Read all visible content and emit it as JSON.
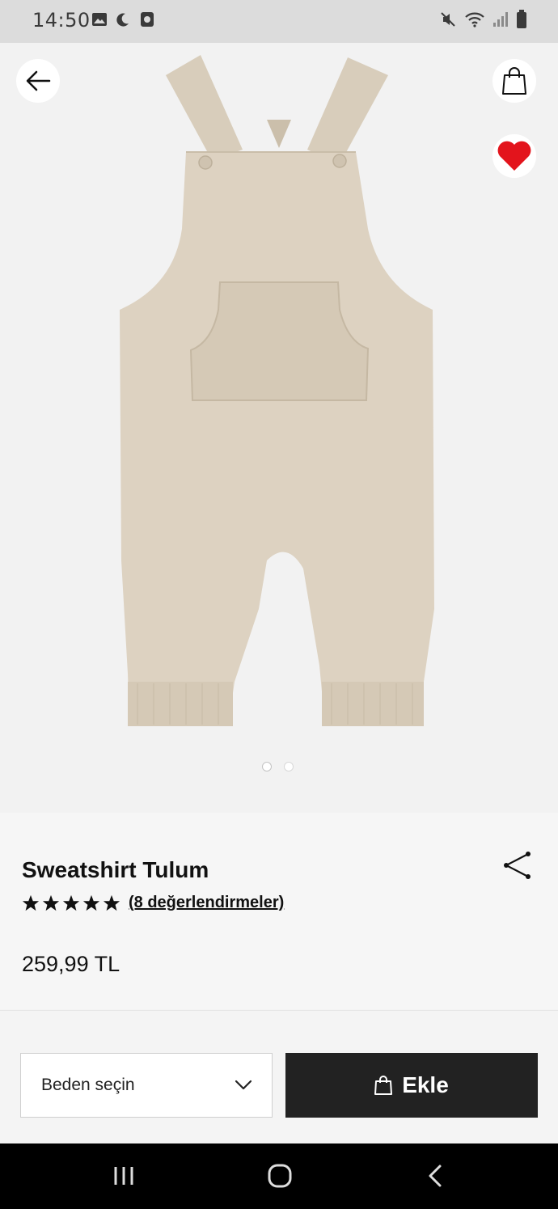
{
  "status_bar": {
    "time": "14:50",
    "left_icons": [
      "image-icon",
      "moon-icon",
      "app-notification-icon"
    ],
    "right_icons": [
      "mute-icon",
      "wifi-icon",
      "signal-icon",
      "battery-icon"
    ]
  },
  "hero": {
    "image_subject": "beige sweatshirt dungarees",
    "page_indicator": {
      "total": 2,
      "active": 1
    }
  },
  "product": {
    "title": "Sweatshirt Tulum",
    "rating_stars": 5,
    "reviews_link": "(8 değerlendirmeler)",
    "price": "259,99 TL"
  },
  "actions": {
    "size_placeholder": "Beden seçin",
    "add_label": "Ekle"
  },
  "colors": {
    "favorite": "#e3141c",
    "button_dark": "#222222",
    "product_beige": "#dcd1c0"
  }
}
